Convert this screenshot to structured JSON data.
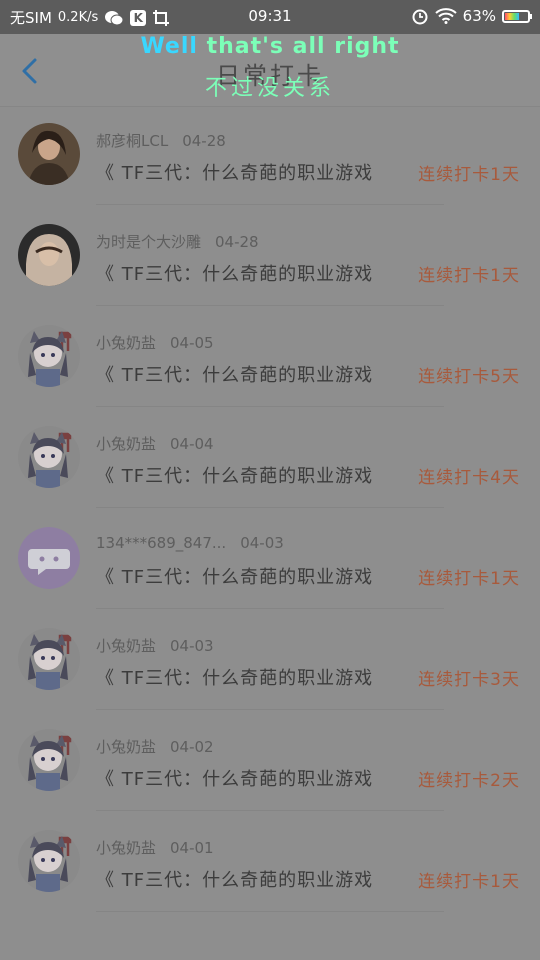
{
  "status_bar": {
    "carrier": "无SIM",
    "speed": "0.2K/s",
    "time": "09:31",
    "battery": "63%",
    "battery_level": 0.63,
    "icons": [
      "wechat-icon",
      "k-app-icon",
      "screenshot-icon",
      "alarm-icon",
      "wifi-icon",
      "battery-icon"
    ]
  },
  "header": {
    "title": "日常打卡",
    "back_icon": "chevron-left-icon",
    "overlay_line1_a": "Well",
    "overlay_line1_b": "that's all right",
    "overlay_line2": "不过没关系"
  },
  "colors": {
    "back": "#2f6fa6",
    "streak": "#a85a3c",
    "overlay_blue": "#39d7ff",
    "overlay_green": "#7cffb8"
  },
  "checkins": [
    {
      "name": "郝彦桐LCL",
      "date": "04-28",
      "message": "《 TF三代：什么奇葩的职业游戏",
      "streak": "连续打卡1天",
      "avatar": "photo-girl-dark"
    },
    {
      "name": "为时是个大沙雕",
      "date": "04-28",
      "message": "《 TF三代：什么奇葩的职业游戏",
      "streak": "连续打卡1天",
      "avatar": "photo-girl-scarf"
    },
    {
      "name": "小兔奶盐",
      "date": "04-05",
      "message": "《 TF三代：什么奇葩的职业游戏",
      "streak": "连续打卡5天",
      "avatar": "anime-girl"
    },
    {
      "name": "小兔奶盐",
      "date": "04-04",
      "message": "《 TF三代：什么奇葩的职业游戏",
      "streak": "连续打卡4天",
      "avatar": "anime-girl"
    },
    {
      "name": "134***689_847...",
      "date": "04-03",
      "message": "《 TF三代：什么奇葩的职业游戏",
      "streak": "连续打卡1天",
      "avatar": "default-chat"
    },
    {
      "name": "小兔奶盐",
      "date": "04-03",
      "message": "《 TF三代：什么奇葩的职业游戏",
      "streak": "连续打卡3天",
      "avatar": "anime-girl"
    },
    {
      "name": "小兔奶盐",
      "date": "04-02",
      "message": "《 TF三代：什么奇葩的职业游戏",
      "streak": "连续打卡2天",
      "avatar": "anime-girl"
    },
    {
      "name": "小兔奶盐",
      "date": "04-01",
      "message": "《 TF三代：什么奇葩的职业游戏",
      "streak": "连续打卡1天",
      "avatar": "anime-girl"
    }
  ]
}
